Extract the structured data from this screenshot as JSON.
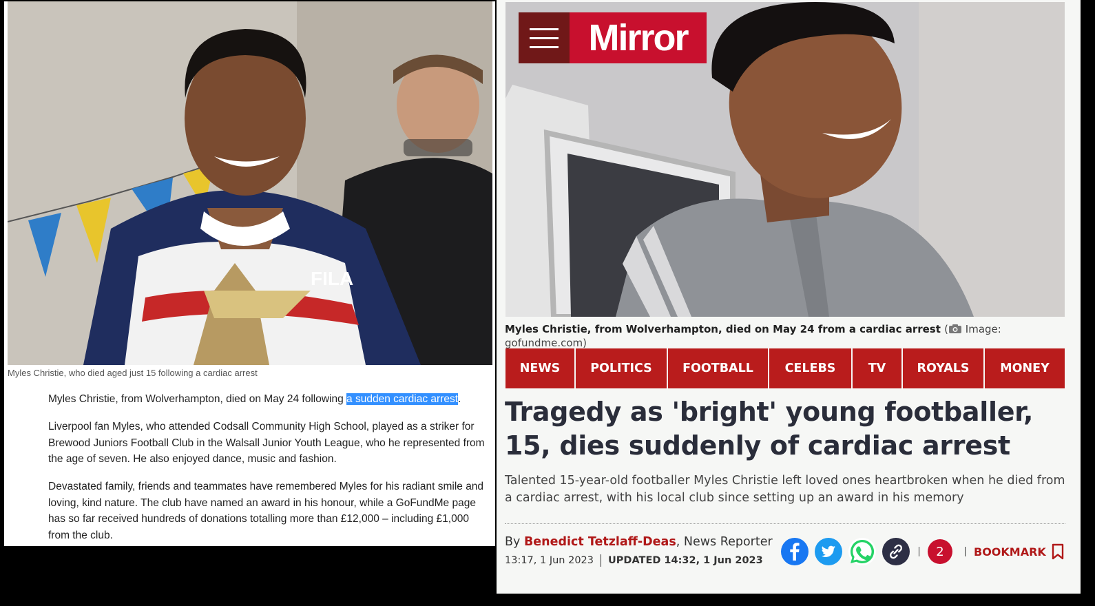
{
  "left_article": {
    "photo_caption": "Myles Christie, who died aged just 15 following a cardiac arrest",
    "p1_before": "Myles Christie, from Wolverhampton, died on May 24 following ",
    "p1_highlight": "a sudden cardiac arrest",
    "p1_after": ".",
    "p2": "Liverpool fan Myles, who attended Codsall Community High School, played as a striker for Brewood Juniors Football Club in the Walsall Junior Youth League, who he represented from the age of seven. He also enjoyed dance, music and fashion.",
    "p3": "Devastated family, friends and teammates have remembered Myles for his radiant smile and loving, kind nature. The club have named an award in his honour, while a GoFundMe page has so far received hundreds of donations totalling more than £12,000 – including £1,000 from the club.",
    "shirt_brand": "FILA"
  },
  "mirror": {
    "brand": "Mirror",
    "photo_caption": "Myles Christie, from Wolverhampton, died on May 24 from a cardiac arrest",
    "photo_credit_open": "(",
    "photo_credit": "Image: gofundme.com",
    "photo_credit_close": ")",
    "nav": [
      "NEWS",
      "POLITICS",
      "FOOTBALL",
      "CELEBS",
      "TV",
      "ROYALS",
      "MONEY"
    ],
    "headline": "Tragedy as 'bright' young footballer, 15, dies suddenly of cardiac arrest",
    "standfirst": "Talented 15-year-old footballer Myles Christie left loved ones heartbroken when he died from a cardiac arrest, with his local club since setting up an award in his memory",
    "byline_prefix": "By",
    "author": "Benedict Tetzlaff-Deas",
    "author_role": ", News Reporter",
    "published": "13:17, 1 Jun 2023",
    "updated": "UPDATED 14:32, 1 Jun 2023",
    "comments_count": "2",
    "bookmark_label": "BOOKMARK"
  },
  "colors": {
    "mirror_red": "#c8102e",
    "nav_red": "#b91c1c",
    "author_red": "#b01818",
    "selection_blue": "#3390ff"
  },
  "icons": [
    "menu-icon",
    "camera-icon",
    "facebook-icon",
    "twitter-icon",
    "whatsapp-icon",
    "link-icon",
    "bookmark-icon"
  ]
}
